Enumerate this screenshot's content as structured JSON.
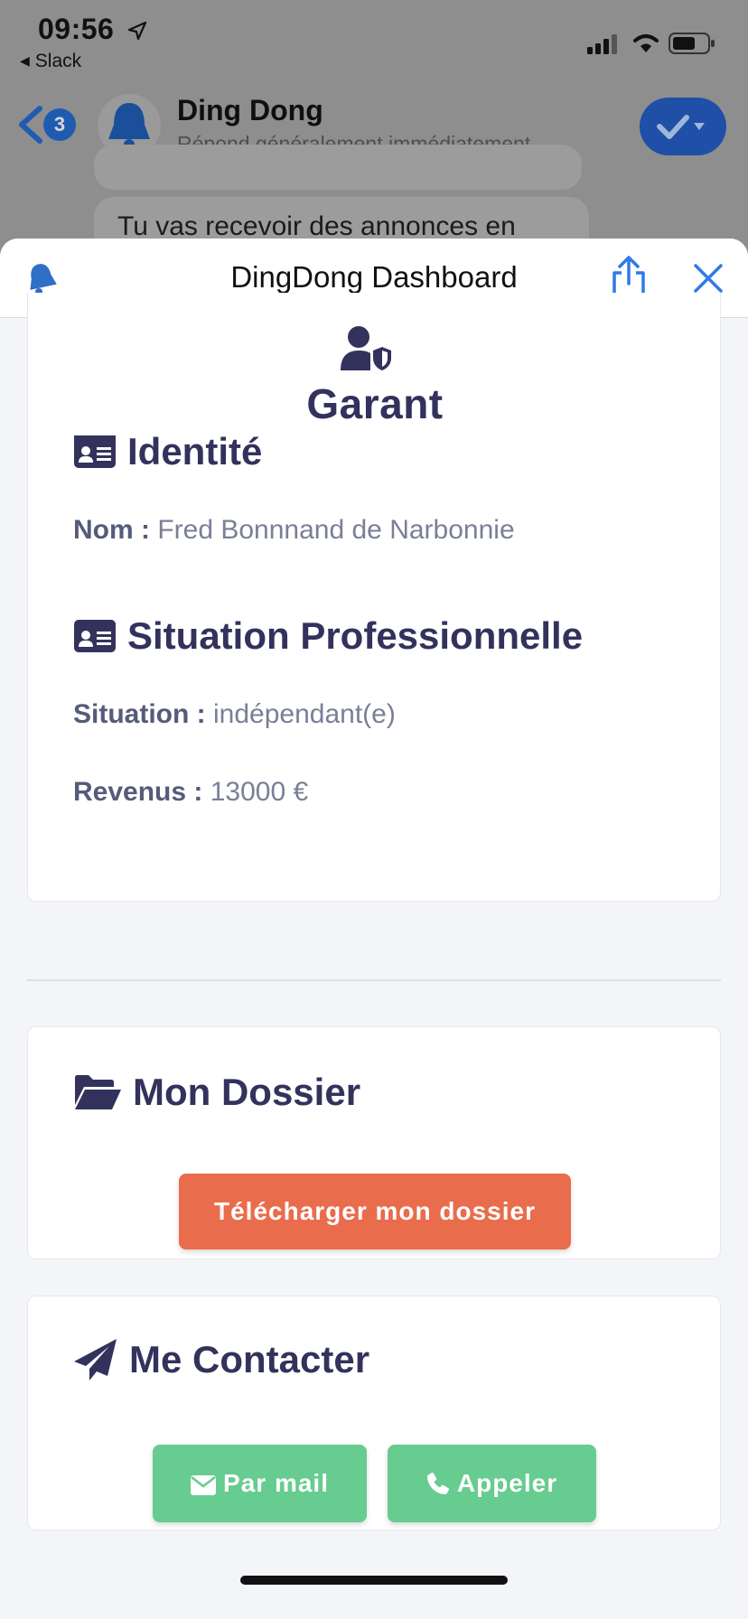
{
  "status_bar": {
    "time": "09:56",
    "back_app": "Slack",
    "icons": [
      "location-arrow-icon",
      "signal-icon",
      "wifi-icon",
      "battery-icon"
    ]
  },
  "chat": {
    "name": "Ding Dong",
    "subtitle": "Répond généralement immédiatement",
    "unread_count": "3",
    "bubble_text": "Tu vas recevoir des annonces en"
  },
  "sheet": {
    "title": "DingDong Dashboard"
  },
  "garant": {
    "title": "Garant",
    "identite_heading": "Identité",
    "nom_label": "Nom :",
    "nom_value": "Fred Bonnnand de Narbonnie",
    "pro_heading": "Situation Professionnelle",
    "situation_label": "Situation :",
    "situation_value": "indépendant(e)",
    "revenus_label": "Revenus :",
    "revenus_value": "13000 €"
  },
  "dossier": {
    "heading": "Mon Dossier",
    "download_label": "Télécharger mon dossier"
  },
  "contact": {
    "heading": "Me Contacter",
    "mail_label": "Par mail",
    "call_label": "Appeler"
  },
  "colors": {
    "heading": "#33325d",
    "ios_blue": "#2f7ae5",
    "download": "#e96c4c",
    "contact": "#66cc8f"
  }
}
